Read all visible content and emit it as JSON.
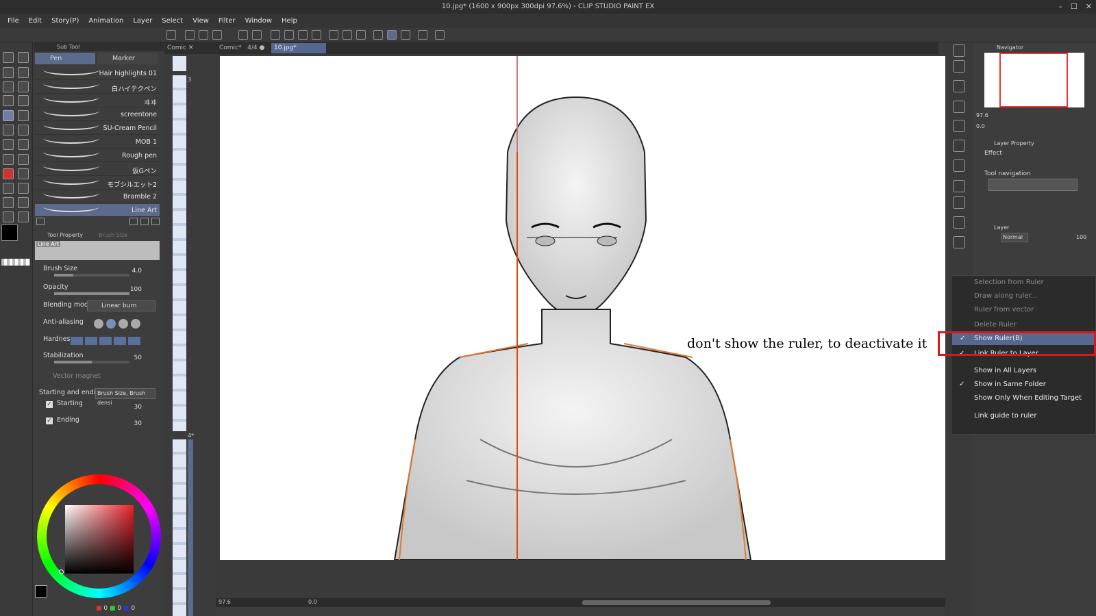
{
  "window": {
    "title": "10.jpg* (1600 x 900px 300dpi 97.6%) - CLIP STUDIO PAINT EX",
    "controls": [
      "–",
      "☐",
      "✕"
    ]
  },
  "menu": [
    "File",
    "Edit",
    "Story(P)",
    "Animation",
    "Layer",
    "Select",
    "View",
    "Filter",
    "Window",
    "Help"
  ],
  "subtool": {
    "header": "Sub Tool",
    "tabs": [
      "Pen",
      "Marker"
    ],
    "brushes": [
      "Hair highlights 01",
      "白ハイテクペン",
      "ヰヰ",
      "screentone",
      "SU-Cream Pencil",
      "MOB 1",
      "Rough pen",
      "仮Gペン",
      "モブシルエット2",
      "Bramble 2",
      "Line Art"
    ]
  },
  "toolprop": {
    "tabs": [
      "Tool Property",
      "Brush Size"
    ],
    "preset_name": "Line Art",
    "brush_size_label": "Brush Size",
    "brush_size": "4.0",
    "opacity_label": "Opacity",
    "opacity": "100",
    "blending_label": "Blending mode",
    "blending": "Linear burn",
    "antialias_label": "Anti-aliasing",
    "hardness_label": "Hardness",
    "stabilization_label": "Stabilization",
    "stabilization": "50",
    "vector_label": "Vector magnet",
    "startend_label": "Starting and ending",
    "startend": "Brush Size, Brush densi",
    "starting_label": "Starting",
    "starting": "30",
    "ending_label": "Ending",
    "ending": "30"
  },
  "color": {
    "r": "0",
    "g": "0",
    "b": "0",
    "accent": "#e8202a"
  },
  "canvas_tabs": [
    "Comic",
    "Comic*",
    "4/4",
    "10.jpg*"
  ],
  "page_numbers": [
    "3",
    "4*"
  ],
  "bottombar": {
    "zoom": "97.6",
    "angle": "0.0"
  },
  "navigator": {
    "title": "Navigator",
    "zoom": "97.6",
    "angle": "0.0"
  },
  "layerprop": {
    "title": "Layer Property",
    "effect_label": "Effect",
    "toolnav_label": "Tool navigation"
  },
  "layer": {
    "title": "Layer",
    "blend": "Normal",
    "opacity": "100"
  },
  "context_menu": {
    "items": [
      {
        "label": "Selection from Ruler",
        "enabled": false,
        "checked": false
      },
      {
        "label": "Draw along ruler...",
        "enabled": false,
        "checked": false
      },
      {
        "label": "Ruler from vector",
        "enabled": false,
        "checked": false
      },
      {
        "label": "Delete Ruler",
        "enabled": false,
        "checked": false
      },
      {
        "label": "Show Ruler(B)",
        "enabled": true,
        "checked": true
      },
      {
        "label": "Link Ruler to Layer",
        "enabled": true,
        "checked": true
      },
      {
        "label": "Show in All Layers",
        "enabled": true,
        "checked": false
      },
      {
        "label": "Show in Same Folder",
        "enabled": true,
        "checked": true
      },
      {
        "label": "Show Only When Editing Target",
        "enabled": true,
        "checked": false
      },
      {
        "label": "Link guide to ruler",
        "enabled": true,
        "checked": false
      }
    ],
    "check": "✓"
  },
  "annotation": "don't show the ruler, to deactivate it",
  "icons": {
    "highlight_color": "#d41a1a",
    "ruler_color": "#e04a10"
  }
}
